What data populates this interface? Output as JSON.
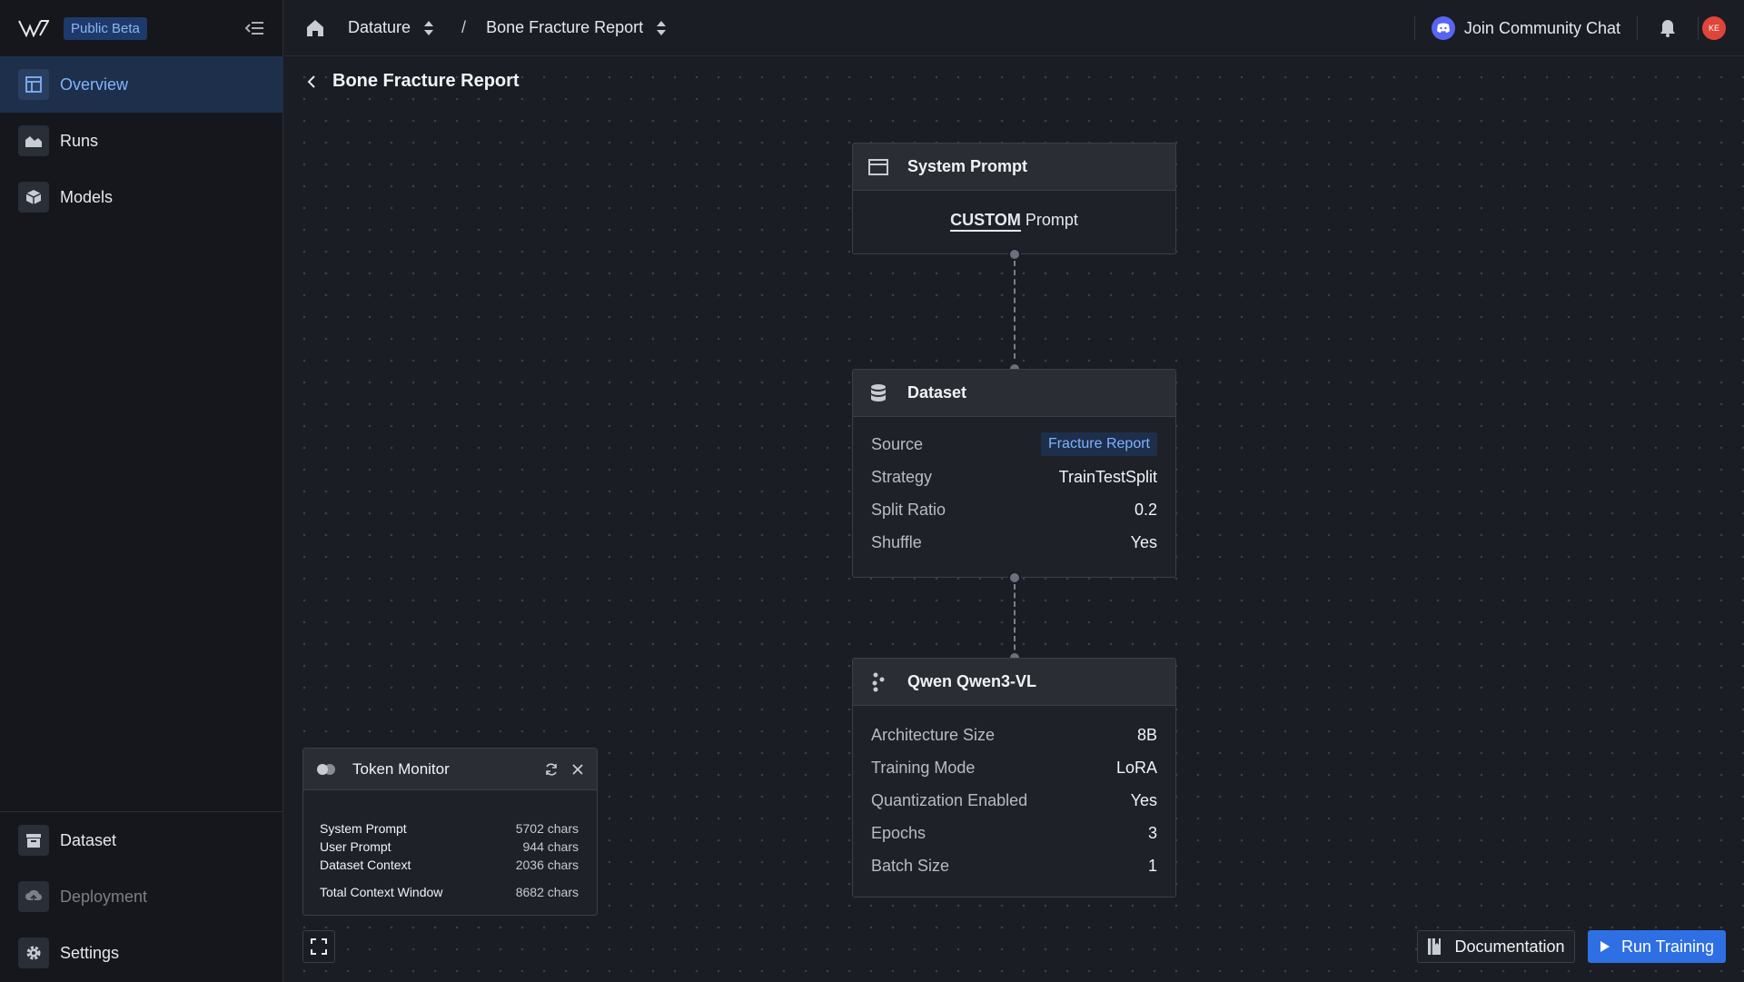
{
  "sidebar": {
    "beta_label": "Public Beta",
    "top_items": [
      {
        "label": "Overview",
        "icon": "layout-icon",
        "active": true
      },
      {
        "label": "Runs",
        "icon": "chart-area-icon"
      },
      {
        "label": "Models",
        "icon": "cube-icon"
      }
    ],
    "bottom_items": [
      {
        "label": "Dataset",
        "icon": "archive-icon"
      },
      {
        "label": "Deployment",
        "icon": "cloud-upload-icon",
        "disabled": true
      },
      {
        "label": "Settings",
        "icon": "gear-icon"
      }
    ]
  },
  "topbar": {
    "breadcrumb": [
      "Datature",
      "Bone Fracture Report"
    ],
    "separator": "/",
    "community_label": "Join Community Chat",
    "avatar_initials": "KE"
  },
  "page": {
    "title": "Bone Fracture Report"
  },
  "nodes": {
    "system_prompt": {
      "title": "System Prompt",
      "custom_word": "CUSTOM",
      "prompt_word": "Prompt"
    },
    "dataset": {
      "title": "Dataset",
      "rows": [
        {
          "key": "Source",
          "value": "Fracture Report",
          "tag": true
        },
        {
          "key": "Strategy",
          "value": "TrainTestSplit"
        },
        {
          "key": "Split Ratio",
          "value": "0.2"
        },
        {
          "key": "Shuffle",
          "value": "Yes"
        }
      ]
    },
    "model": {
      "title": "Qwen Qwen3-VL",
      "rows": [
        {
          "key": "Architecture Size",
          "value": "8B"
        },
        {
          "key": "Training Mode",
          "value": "LoRA"
        },
        {
          "key": "Quantization Enabled",
          "value": "Yes"
        },
        {
          "key": "Epochs",
          "value": "3"
        },
        {
          "key": "Batch Size",
          "value": "1"
        }
      ]
    }
  },
  "token_monitor": {
    "title": "Token Monitor",
    "rows": [
      {
        "label": "System Prompt",
        "value": "5702 chars"
      },
      {
        "label": "User Prompt",
        "value": "944 chars"
      },
      {
        "label": "Dataset Context",
        "value": "2036 chars"
      }
    ],
    "total": {
      "label": "Total Context Window",
      "value": "8682 chars"
    }
  },
  "actions": {
    "documentation_label": "Documentation",
    "run_label": "Run Training"
  },
  "colors": {
    "accent": "#2f6fe4",
    "active_nav_bg": "#1d2f4b",
    "active_nav_text": "#7fb2ff",
    "background": "#1a1d23"
  }
}
